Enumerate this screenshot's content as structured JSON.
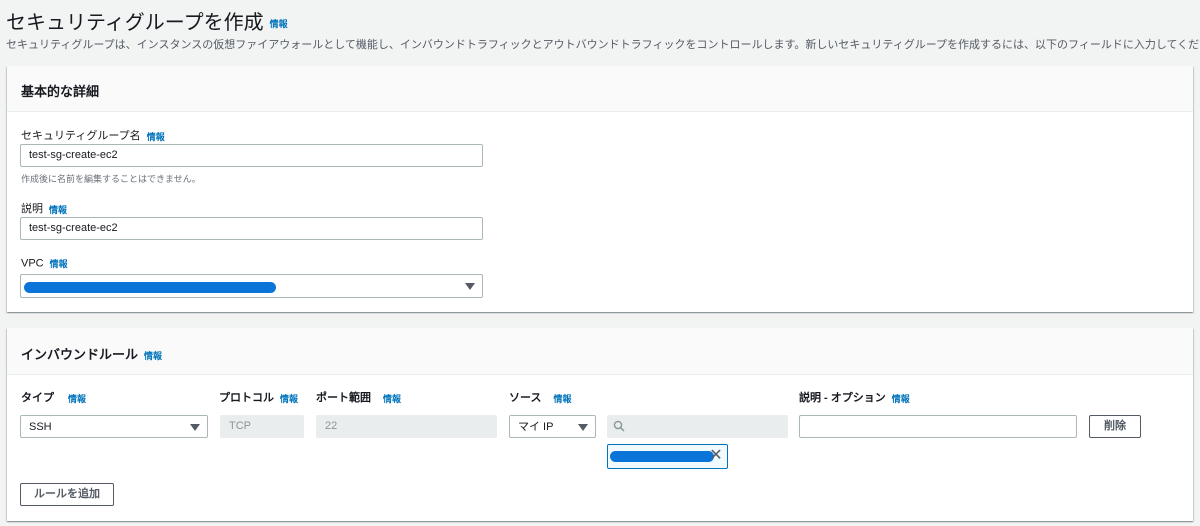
{
  "page": {
    "title": "セキュリティグループを作成",
    "info": "情報",
    "description": "セキュリティグループは、インスタンスの仮想ファイアウォールとして機能し、インバウンドトラフィックとアウトバウンドトラフィックをコントロールします。新しいセキュリティグループを作成するには、以下のフィールドに入力してください。"
  },
  "basic": {
    "heading": "基本的な詳細",
    "name_label": "セキュリティグループ名",
    "name_info": "情報",
    "name_value": "test-sg-create-ec2",
    "name_hint": "作成後に名前を編集することはできません。",
    "desc_label": "説明",
    "desc_info": "情報",
    "desc_value": "test-sg-create-ec2",
    "vpc_label": "VPC",
    "vpc_info": "情報"
  },
  "inbound": {
    "heading": "インバウンドルール",
    "info": "情報",
    "columns": {
      "type": "タイプ",
      "type_info": "情報",
      "protocol": "プロトコル",
      "protocol_info": "情報",
      "port": "ポート範囲",
      "port_info": "情報",
      "source": "ソース",
      "source_info": "情報",
      "desc": "説明 - オプション",
      "desc_info": "情報"
    },
    "rule": {
      "type": "SSH",
      "protocol": "TCP",
      "port": "22",
      "source": "マイ IP",
      "description": ""
    },
    "delete_label": "削除",
    "add_rule_label": "ルールを追加"
  },
  "colors": {
    "link": "#0073bb",
    "redaction": "#0a74d8",
    "background": "#f2f3f3"
  }
}
